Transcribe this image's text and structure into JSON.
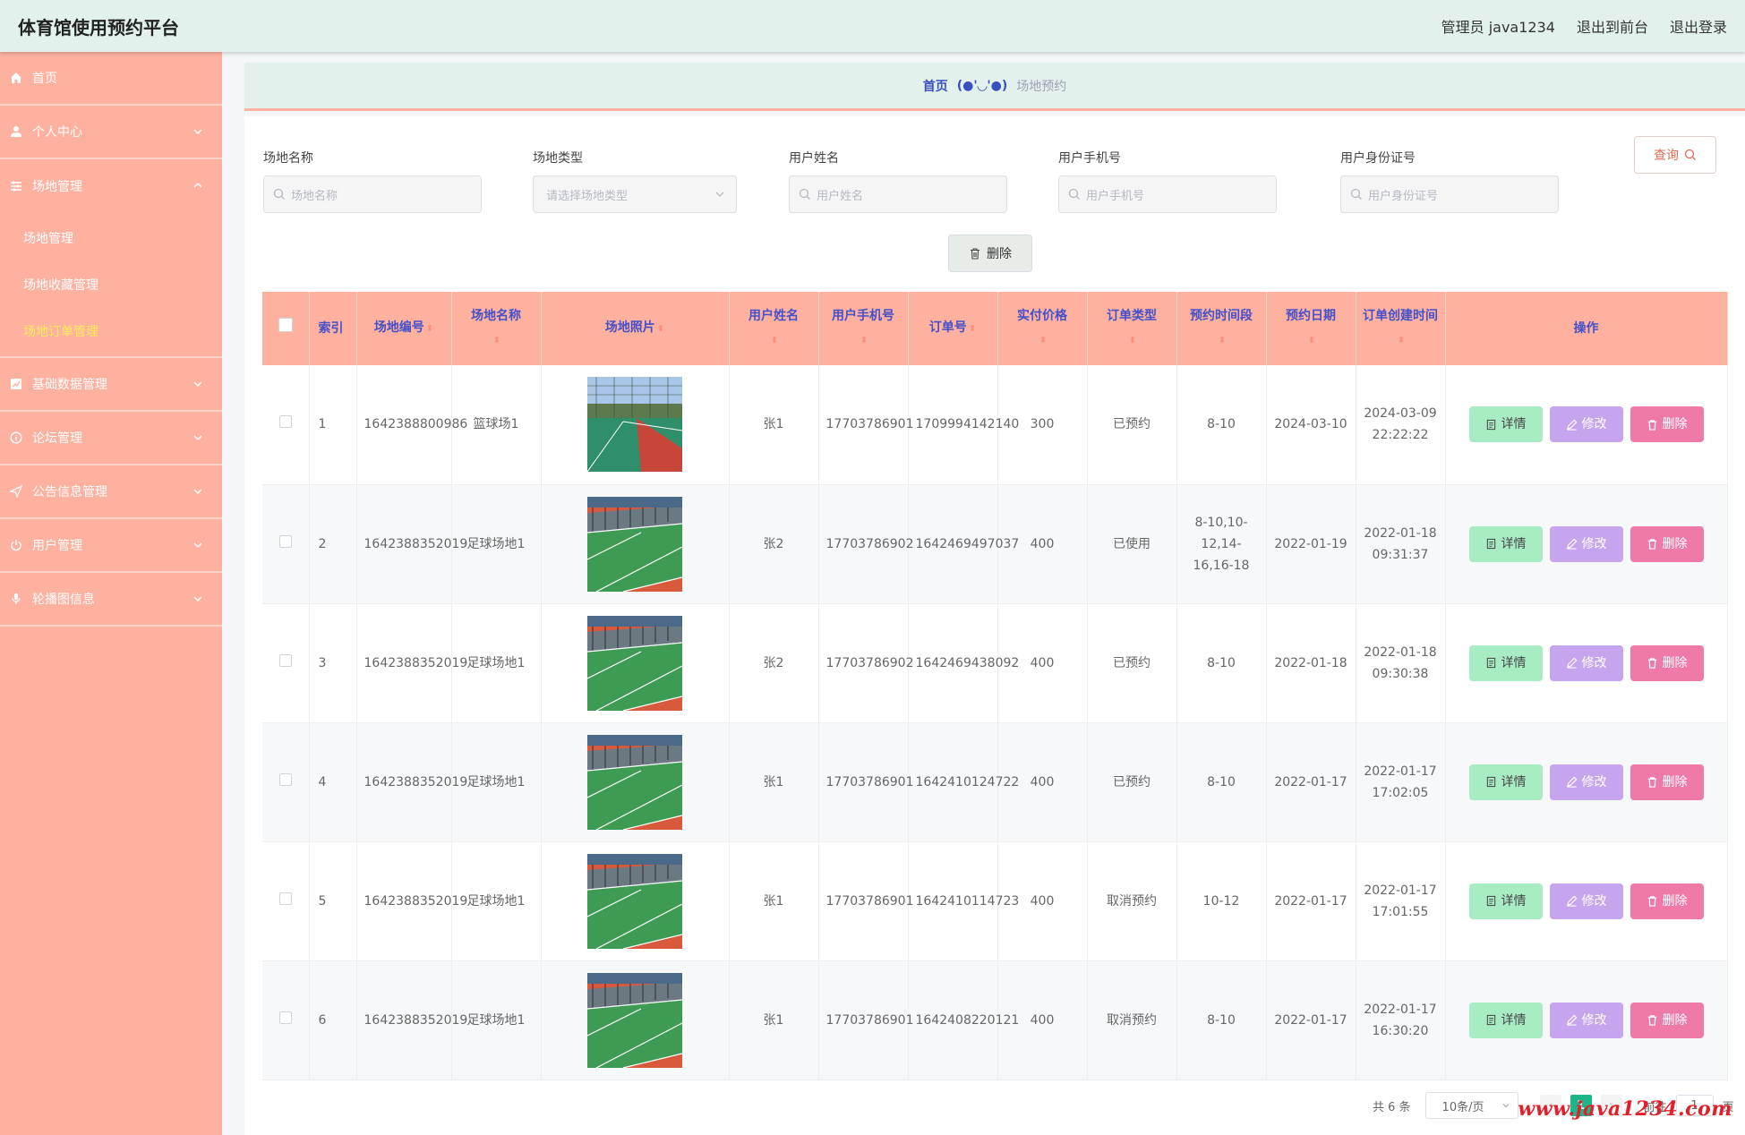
{
  "header": {
    "title": "体育馆使用预约平台",
    "admin_label": "管理员 java1234",
    "to_front": "退出到前台",
    "logout": "退出登录"
  },
  "sidebar": {
    "items": [
      {
        "label": "首页",
        "icon": "home-icon"
      },
      {
        "label": "个人中心",
        "icon": "user-icon"
      },
      {
        "label": "场地管理",
        "icon": "sliders-icon"
      },
      {
        "label": "基础数据管理",
        "icon": "chart-icon"
      },
      {
        "label": "论坛管理",
        "icon": "info-icon"
      },
      {
        "label": "公告信息管理",
        "icon": "send-icon"
      },
      {
        "label": "用户管理",
        "icon": "power-icon"
      },
      {
        "label": "轮播图信息",
        "icon": "mic-icon"
      }
    ],
    "submenu": [
      "场地管理",
      "场地收藏管理",
      "场地订单管理"
    ]
  },
  "breadcrumb": {
    "home": "首页",
    "sep": "(●'◡'●)",
    "current": "场地预约"
  },
  "filters": [
    {
      "label": "场地名称",
      "placeholder": "场地名称"
    },
    {
      "label": "场地类型",
      "placeholder": "请选择场地类型"
    },
    {
      "label": "用户姓名",
      "placeholder": "用户姓名"
    },
    {
      "label": "用户手机号",
      "placeholder": "用户手机号"
    },
    {
      "label": "用户身份证号",
      "placeholder": "用户身份证号"
    }
  ],
  "buttons": {
    "query": "查询",
    "batch_delete": "删除"
  },
  "table": {
    "headers": [
      "索引",
      "场地编号",
      "场地名称",
      "场地照片",
      "用户姓名",
      "用户手机号",
      "订单号",
      "实付价格",
      "订单类型",
      "预约时间段",
      "预约日期",
      "订单创建时间",
      "操作"
    ],
    "actions": {
      "detail": "详情",
      "edit": "修改",
      "delete": "删除"
    },
    "rows": [
      {
        "index": "1",
        "venue_no": "1642388800986",
        "venue_name": "篮球场1",
        "user": "张1",
        "phone": "17703786901",
        "order_no": "1709994142140",
        "price": "300",
        "type": "已预约",
        "slot": "8-10",
        "date": "2024-03-10",
        "created": "2024-03-09 22:22:22",
        "photo": "basketball"
      },
      {
        "index": "2",
        "venue_no": "1642388352019",
        "venue_name": "足球场地1",
        "user": "张2",
        "phone": "17703786902",
        "order_no": "1642469497037",
        "price": "400",
        "type": "已使用",
        "slot": "8-10,10-12,14-16,16-18",
        "date": "2022-01-19",
        "created": "2022-01-18 09:31:37",
        "photo": "court"
      },
      {
        "index": "3",
        "venue_no": "1642388352019",
        "venue_name": "足球场地1",
        "user": "张2",
        "phone": "17703786902",
        "order_no": "1642469438092",
        "price": "400",
        "type": "已预约",
        "slot": "8-10",
        "date": "2022-01-18",
        "created": "2022-01-18 09:30:38",
        "photo": "court"
      },
      {
        "index": "4",
        "venue_no": "1642388352019",
        "venue_name": "足球场地1",
        "user": "张1",
        "phone": "17703786901",
        "order_no": "1642410124722",
        "price": "400",
        "type": "已预约",
        "slot": "8-10",
        "date": "2022-01-17",
        "created": "2022-01-17 17:02:05",
        "photo": "court"
      },
      {
        "index": "5",
        "venue_no": "1642388352019",
        "venue_name": "足球场地1",
        "user": "张1",
        "phone": "17703786901",
        "order_no": "1642410114723",
        "price": "400",
        "type": "取消预约",
        "slot": "10-12",
        "date": "2022-01-17",
        "created": "2022-01-17 17:01:55",
        "photo": "court"
      },
      {
        "index": "6",
        "venue_no": "1642388352019",
        "venue_name": "足球场地1",
        "user": "张1",
        "phone": "17703786901",
        "order_no": "1642408220121",
        "price": "400",
        "type": "取消预约",
        "slot": "8-10",
        "date": "2022-01-17",
        "created": "2022-01-17 16:30:20",
        "photo": "court"
      }
    ]
  },
  "pagination": {
    "total": "共 6 条",
    "page_size": "10条/页",
    "current": "1",
    "goto_prefix": "前往",
    "goto_value": "1",
    "goto_suffix": "页"
  },
  "watermark": "www.java1234.com",
  "colors": {
    "sidebar": "#ffb1a0",
    "header": "#e3f1ec",
    "table_head": "#ffb1a0",
    "detail": "#a8ecc4",
    "edit": "#c7a4ee",
    "delete": "#f07aa7",
    "active_page": "#1fb58b"
  }
}
